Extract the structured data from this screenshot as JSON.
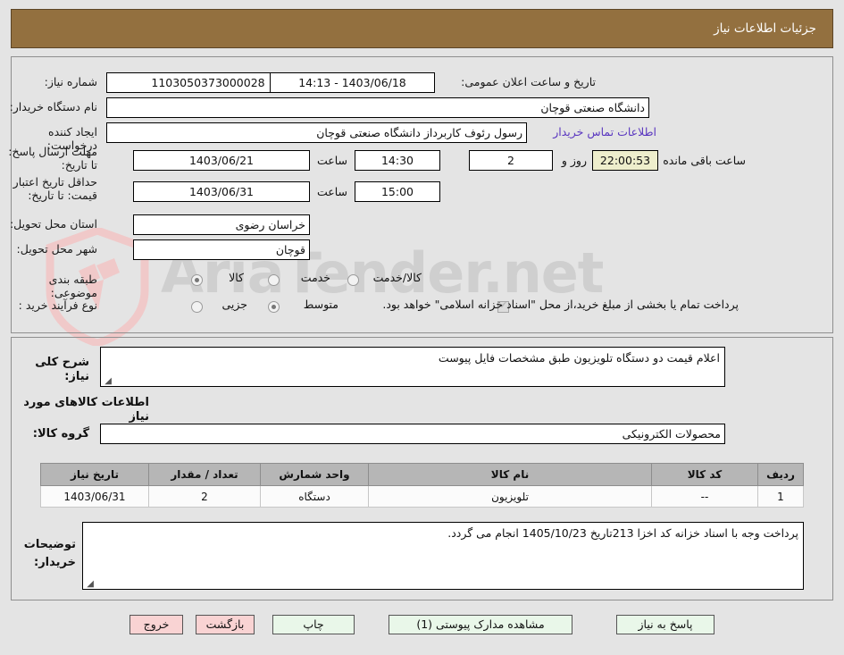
{
  "header": {
    "title": "جزئیات اطلاعات نیاز"
  },
  "form": {
    "need_number": {
      "label": "شماره نیاز:",
      "value": "1103050373000028"
    },
    "announce_datetime": {
      "label": "تاریخ و ساعت اعلان عمومی:",
      "value": "1403/06/18 - 14:13"
    },
    "buyer_org": {
      "label": "نام دستگاه خریدار:",
      "value": "دانشگاه صنعتی قوچان"
    },
    "requester": {
      "label": "ایجاد کننده درخواست:",
      "value": "رسول رئوف کاربرداز دانشگاه صنعتی قوچان"
    },
    "contact_link": {
      "label": "اطلاعات تماس خریدار",
      "value": ""
    },
    "response_deadline": {
      "label": "مهلت ارسال پاسخ: تا تاریخ:",
      "date": "1403/06/21",
      "time_label": "ساعت",
      "time": "14:30",
      "days": "2",
      "days_label": "روز و",
      "countdown": "22:00:53",
      "remaining_label": "ساعت باقی مانده"
    },
    "price_validity": {
      "label": "حداقل تاریخ اعتبار قیمت: تا تاریخ:",
      "date": "1403/06/31",
      "time_label": "ساعت",
      "time": "15:00"
    },
    "province": {
      "label": "استان محل تحویل:",
      "value": "خراسان رضوی"
    },
    "city": {
      "label": "شهر محل تحویل:",
      "value": "قوچان"
    },
    "category": {
      "label": "طبقه بندی موضوعی:",
      "options": [
        "کالا",
        "خدمت",
        "کالا/خدمت"
      ],
      "selected": "کالا"
    },
    "process_type": {
      "label": "نوع فرآیند خرید :",
      "options": [
        "جزیی",
        "متوسط"
      ],
      "selected": "متوسط"
    },
    "treasury_note": {
      "checked": true,
      "text": "پرداخت تمام یا بخشی از مبلغ خرید،از محل \"اسناد خزانه اسلامی\" خواهد بود."
    }
  },
  "details": {
    "summary": {
      "label": "شرح کلی نیاز:",
      "value": "اعلام قیمت دو دستگاه تلویزیون طبق مشخصات فایل پیوست"
    },
    "goods_section_title": "اطلاعات کالاهای مورد نیاز",
    "goods_group": {
      "label": "گروه کالا:",
      "value": "محصولات الکترونیکی"
    },
    "table": {
      "columns": [
        "ردیف",
        "کد کالا",
        "نام کالا",
        "واحد شمارش",
        "تعداد / مقدار",
        "تاریخ نیاز"
      ],
      "rows": [
        [
          "1",
          "--",
          "تلویزیون",
          "دستگاه",
          "2",
          "1403/06/31"
        ]
      ]
    },
    "buyer_comments": {
      "label": "توضیحات خریدار:",
      "value": "پرداخت وجه با اسناد خزانه کد اخزا 213تاریخ 1405/10/23 انجام می گردد."
    }
  },
  "buttons": {
    "respond": "پاسخ به نیاز",
    "attachments": "مشاهده مدارک پیوستی (1)",
    "print": "چاپ",
    "back": "بازگشت",
    "exit": "خروج"
  },
  "watermark": {
    "text": "AriaTender.net"
  },
  "colors": {
    "header_bg": "#93703f",
    "page_bg": "#e4e4e4",
    "link": "#5a37c0",
    "timer_bg": "#eeeecc",
    "btn_green": "#e9f7e9",
    "btn_pink": "#f9d3d3",
    "table_header_bg": "#b6b6b6"
  }
}
